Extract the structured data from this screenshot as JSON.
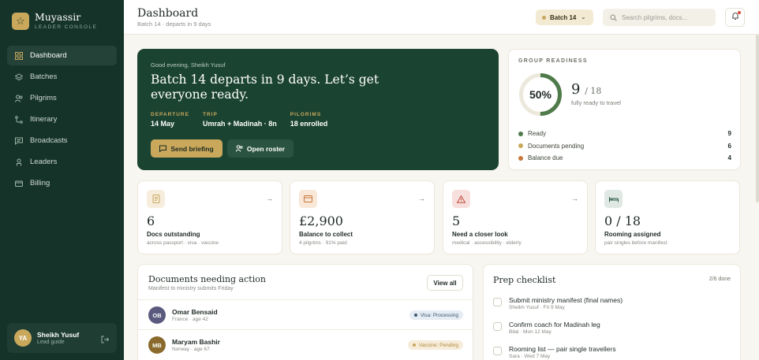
{
  "sidebar": {
    "brand_name": "Muyassir",
    "brand_sub": "LEADER CONSOLE",
    "items": [
      {
        "label": "Dashboard",
        "icon": "grid-icon",
        "active": true
      },
      {
        "label": "Batches",
        "icon": "layers-icon",
        "active": false
      },
      {
        "label": "Pilgrims",
        "icon": "users-icon",
        "active": false
      },
      {
        "label": "Itinerary",
        "icon": "route-icon",
        "active": false
      },
      {
        "label": "Broadcasts",
        "icon": "message-icon",
        "active": false
      },
      {
        "label": "Leaders",
        "icon": "badge-icon",
        "active": false
      },
      {
        "label": "Billing",
        "icon": "card-icon",
        "active": false
      }
    ],
    "user": {
      "initials": "YA",
      "name": "Sheikh Yusuf",
      "role": "Lead guide"
    }
  },
  "header": {
    "title": "Dashboard",
    "subtitle": "Batch 14 · departs in 9 days",
    "batch_label": "Batch 14",
    "search_placeholder": "Search pilgrims, docs..."
  },
  "hero": {
    "greeting": "Good evening, Sheikh Yusuf",
    "title": "Batch 14 departs in 9 days. Let’s get everyone ready.",
    "stats": [
      {
        "label": "DEPARTURE",
        "value": "14 May"
      },
      {
        "label": "TRIP",
        "value": "Umrah + Madinah · 8n"
      },
      {
        "label": "PILGRIMS",
        "value": "18 enrolled"
      }
    ],
    "primary_button": "Send briefing",
    "secondary_button": "Open roster"
  },
  "readiness": {
    "title": "GROUP READINESS",
    "percent_label": "50%",
    "percent": 0.5,
    "count": "9",
    "total": "/ 18",
    "subtitle": "fully ready to travel",
    "legend": [
      {
        "label": "Ready",
        "value": "9",
        "color": "#4f7a4a"
      },
      {
        "label": "Documents pending",
        "value": "6",
        "color": "#c9a85c"
      },
      {
        "label": "Balance due",
        "value": "4",
        "color": "#c8783c"
      }
    ]
  },
  "stats": [
    {
      "value": "6",
      "label": "Docs outstanding",
      "sub": "across passport · visa · vaccine",
      "icon": "document-icon",
      "bg": "#f7eddd",
      "color": "#c9a85c"
    },
    {
      "value": "£2,900",
      "label": "Balance to collect",
      "sub": "4 pilgrims · 91% paid",
      "icon": "card-icon",
      "bg": "#f9e7d7",
      "color": "#c8783c"
    },
    {
      "value": "5",
      "label": "Need a closer look",
      "sub": "medical · accessibility · elderly",
      "icon": "alert-icon",
      "bg": "#f6dfdc",
      "color": "#c14a3a"
    },
    {
      "value": "0 / 18",
      "label": "Rooming assigned",
      "sub": "pair singles before manifest",
      "icon": "bed-icon",
      "bg": "#dfe8e3",
      "color": "#2f5b48"
    }
  ],
  "documents": {
    "title": "Documents needing action",
    "subtitle": "Manifest to ministry submits Friday",
    "view_all": "View all",
    "rows": [
      {
        "initials": "OB",
        "name": "Omar Bensaid",
        "meta": "France · age 42",
        "badge": "Visa: Processing",
        "avatar_color": "#5a5a7e",
        "badge_bg": "#e6ecf3",
        "badge_color": "#3c5674",
        "badge_dot": "#3c5674"
      },
      {
        "initials": "MB",
        "name": "Maryam Bashir",
        "meta": "Norway · age 67",
        "badge": "Vaccine: Pending",
        "avatar_color": "#8a6a2c",
        "badge_bg": "#f6ecd9",
        "badge_color": "#b08a3c",
        "badge_dot": "#c9a85c"
      }
    ]
  },
  "checklist": {
    "title": "Prep checklist",
    "count": "2/6 done",
    "items": [
      {
        "text": "Submit ministry manifest (final names)",
        "meta": "Sheikh Yusuf · Fri 9 May"
      },
      {
        "text": "Confirm coach for Madinah leg",
        "meta": "Bilal · Mon 12 May"
      },
      {
        "text": "Rooming list — pair single travellers",
        "meta": "Sara · Wed 7 May"
      }
    ]
  }
}
